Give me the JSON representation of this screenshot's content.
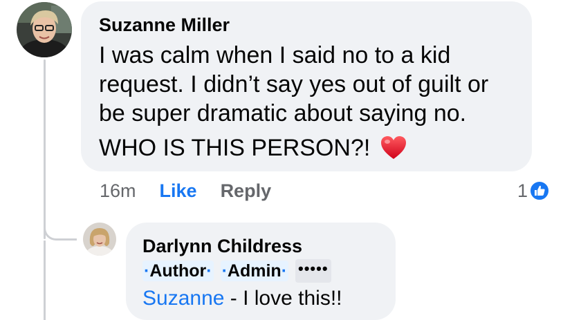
{
  "comment": {
    "author": "Suzanne Miller",
    "lines": [
      "I was calm when I said no to a kid",
      "request. I didn’t say yes out of guilt or",
      "be super dramatic about saying no."
    ],
    "line2": "WHO IS THIS PERSON?!",
    "emoji_icon": "red-heart-icon",
    "time": "16m",
    "like_label": "Like",
    "reply_label": "Reply",
    "reaction_count": "1",
    "reaction_icon": "thumbs-up-icon"
  },
  "reply": {
    "author": "Darlynn Childress",
    "badges": [
      "Author",
      "Admin"
    ],
    "more_badge": "•••••",
    "mention": "Suzanne",
    "text": " - I love this!!"
  },
  "colors": {
    "link_blue": "#1877f2",
    "bubble_bg": "#f0f2f5",
    "secondary_text": "#65676b",
    "badge_bg": "#e7f3ff",
    "thread_line": "#ced0d4"
  }
}
